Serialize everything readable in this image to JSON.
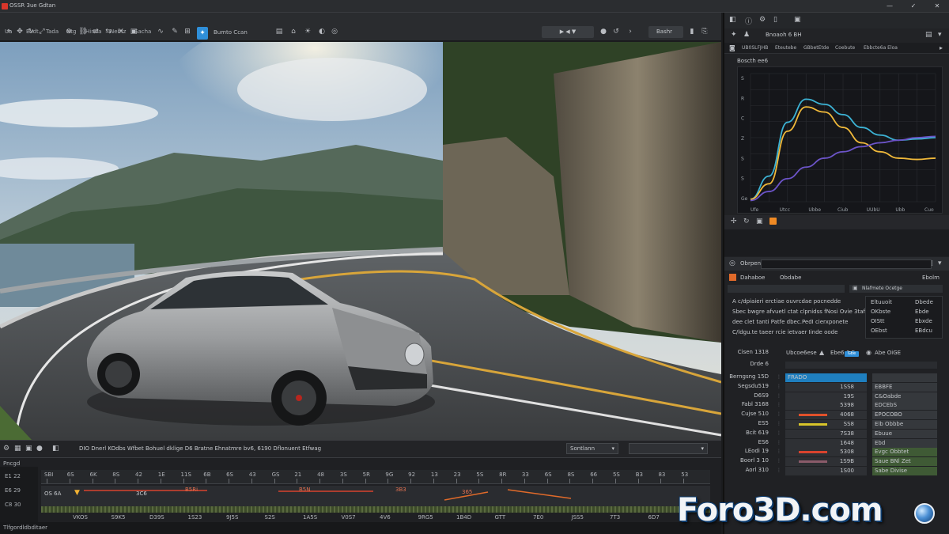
{
  "window": {
    "title": "OSSR 3ue Gdtan",
    "controls": [
      "—",
      "✓",
      "✕"
    ]
  },
  "menu": [
    "Ua",
    "Exdt",
    "Tada",
    "Ntg",
    "Hinda",
    "Nebtz",
    "Sacha"
  ],
  "toolbar": {
    "label": "Bumto Ccan",
    "playback": "▶ ◀ ▼",
    "renderer": "Bashr"
  },
  "viewport": {
    "status": "DIO Dnerl KOdbs Wfbet Bohuel dklige D6 Bratne Ehnatmre bv6, 6190 Dflonuent Etfwag",
    "view_select": "Sontlann",
    "view_field": ""
  },
  "timeline": {
    "header": "Pncgd",
    "labels": [
      "E1 22",
      "E6 29",
      "C8 30"
    ],
    "track_label": "OS 6A",
    "footer": "Tlfgordldbditaer",
    "ruler": [
      "SBI",
      "6S",
      "6K",
      "8S",
      "42",
      "1E",
      "11S",
      "6B",
      "6S",
      "43",
      "GS",
      "21",
      "48",
      "3S",
      "5R",
      "9G",
      "92",
      "13",
      "23",
      "5S",
      "8R",
      "33",
      "6S",
      "8S",
      "66",
      "5S",
      "B3",
      "83",
      "53"
    ],
    "frames": [
      "VKOS",
      "S9K5",
      "D39S",
      "1S23",
      "9J5S",
      "S2S",
      "1A5S",
      "V0S7",
      "4V6",
      "9RG5",
      "1B4D",
      "GTT",
      "7E0",
      "JSS5",
      "7T3",
      "6D7"
    ],
    "track_marks": [
      "3C6",
      "B5Ri",
      "B5N",
      "3B3",
      "365"
    ]
  },
  "graph_panel": {
    "header": "Bnoaoh 6 BH",
    "tabs": [
      "UB0SLFJHB",
      "Eteutebe",
      "GBbetEtde",
      "Coebute",
      "Ebbcte6a Eloa"
    ],
    "title": "Boscth ee6",
    "x_ticks": [
      "Ufe",
      "Utcc",
      "Ubbe",
      "Ciub",
      "UUbU",
      "Ubb",
      "Cuo"
    ],
    "y_ticks": [
      "S",
      "R",
      "C",
      "Z",
      "S",
      "S",
      "Ge"
    ]
  },
  "chart_data": {
    "type": "line",
    "x": [
      0,
      1,
      2,
      3,
      4,
      5,
      6,
      7,
      8,
      9,
      10
    ],
    "series": [
      {
        "color": "#3cb2d4",
        "values": [
          0.02,
          0.2,
          0.62,
          0.8,
          0.76,
          0.68,
          0.58,
          0.52,
          0.48,
          0.49,
          0.5
        ]
      },
      {
        "color": "#f0b93a",
        "values": [
          0.02,
          0.14,
          0.55,
          0.74,
          0.7,
          0.58,
          0.46,
          0.39,
          0.34,
          0.33,
          0.34
        ]
      },
      {
        "color": "#6c54c8",
        "values": [
          0.01,
          0.08,
          0.18,
          0.27,
          0.34,
          0.39,
          0.43,
          0.46,
          0.48,
          0.5,
          0.51
        ]
      }
    ],
    "ylim": [
      0,
      1
    ],
    "grid": true
  },
  "properties": {
    "header": "Obrpen",
    "subheader": [
      "Dahaboe",
      "Obdabe"
    ],
    "right_label": "Ebolm",
    "material": "Nlafmete Ocetge",
    "description": [
      "A c/dpiaieri erctiae ouvrcdae pocnedde",
      "Sbec bwgre afvuetl ctat clpnidss fNosi Ovie 3tafo",
      "dee clet tanti Patfe dbec.PedI cierxponete",
      "C/ldgu.te taeer rcie ietvaer Iinde oode"
    ],
    "side_list": [
      {
        "k": "Eltuuoit",
        "v": "Dbede"
      },
      {
        "k": "OKbste",
        "v": "Ebde"
      },
      {
        "k": "OIStt",
        "v": "Ebxde"
      },
      {
        "k": "OEbst",
        "v": "EBdcu"
      }
    ],
    "toggles": {
      "label1": "Cisen 1318",
      "label2": "Drde 6",
      "opt1": "Ubcoe6ese",
      "opt2": "Ebe6 6 E",
      "badge": "Gbe",
      "opt3": "Abe OiGE"
    },
    "params": [
      {
        "label": "Berngsng 15D",
        "a": "FRADO",
        "b": "",
        "green": false
      },
      {
        "label": "Segsdu519",
        "a": "",
        "av": "1SS8",
        "b": "EBBFE",
        "green": false
      },
      {
        "label": "D6S9",
        "a": "",
        "av": "19S",
        "b": "C&Oabde",
        "green": false
      },
      {
        "label": "Fabl 3168",
        "a": "",
        "av": "5398",
        "b": "EDCEbS",
        "green": false
      },
      {
        "label": "Cujse 510",
        "a": "",
        "av": "4068",
        "b": "EPOCOBO",
        "green": false
      },
      {
        "label": "ES5",
        "a": "",
        "av": "SS8",
        "b": "Elb Obbbe",
        "green": false
      },
      {
        "label": "Bcit 619",
        "a": "",
        "av": "7S38",
        "b": "Ebuue",
        "green": false
      },
      {
        "label": "ES6",
        "a": "",
        "av": "1648",
        "b": "Ebd",
        "green": false
      },
      {
        "label": "LEodi 19",
        "a": "",
        "av": "5308",
        "b": "Evgc Obbtet",
        "green": true
      },
      {
        "label": "Boorl 3 10",
        "a": "",
        "av": "1S9B",
        "b": "Saue BNl Zet",
        "green": true
      },
      {
        "label": "Aorl 310",
        "a": "",
        "av": "1S00",
        "b": "Sabe Divise",
        "green": true
      }
    ]
  },
  "watermark": {
    "text": "Foro3D.com"
  }
}
